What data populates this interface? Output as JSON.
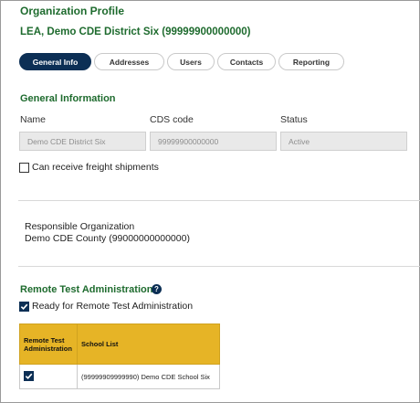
{
  "page": {
    "title": "Organization Profile",
    "subtitle": "LEA, Demo CDE District Six (99999900000000)"
  },
  "tabs": [
    {
      "label": "General Info",
      "active": true
    },
    {
      "label": "Addresses",
      "active": false
    },
    {
      "label": "Users",
      "active": false
    },
    {
      "label": "Contacts",
      "active": false
    },
    {
      "label": "Reporting",
      "active": false
    }
  ],
  "general": {
    "heading": "General Information",
    "name_label": "Name",
    "name_value": "Demo CDE District Six",
    "cds_label": "CDS code",
    "cds_value": "99999900000000",
    "status_label": "Status",
    "status_value": "Active",
    "freight_label": "Can receive freight shipments",
    "freight_checked": false
  },
  "responsible": {
    "label": "Responsible Organization",
    "value": "Demo CDE County (99000000000000)"
  },
  "remote": {
    "heading": "Remote Test Administration",
    "help_glyph": "?",
    "ready_label": "Ready for Remote Test Administration",
    "ready_checked": true,
    "table": {
      "headers": [
        "Remote Test Administration",
        "School List"
      ],
      "rows": [
        {
          "checked": true,
          "school": "(99999909999990) Demo CDE School Six"
        }
      ]
    }
  },
  "colors": {
    "accent_green": "#1e6b2e",
    "navy": "#0c2f55",
    "table_header": "#e6b426"
  }
}
